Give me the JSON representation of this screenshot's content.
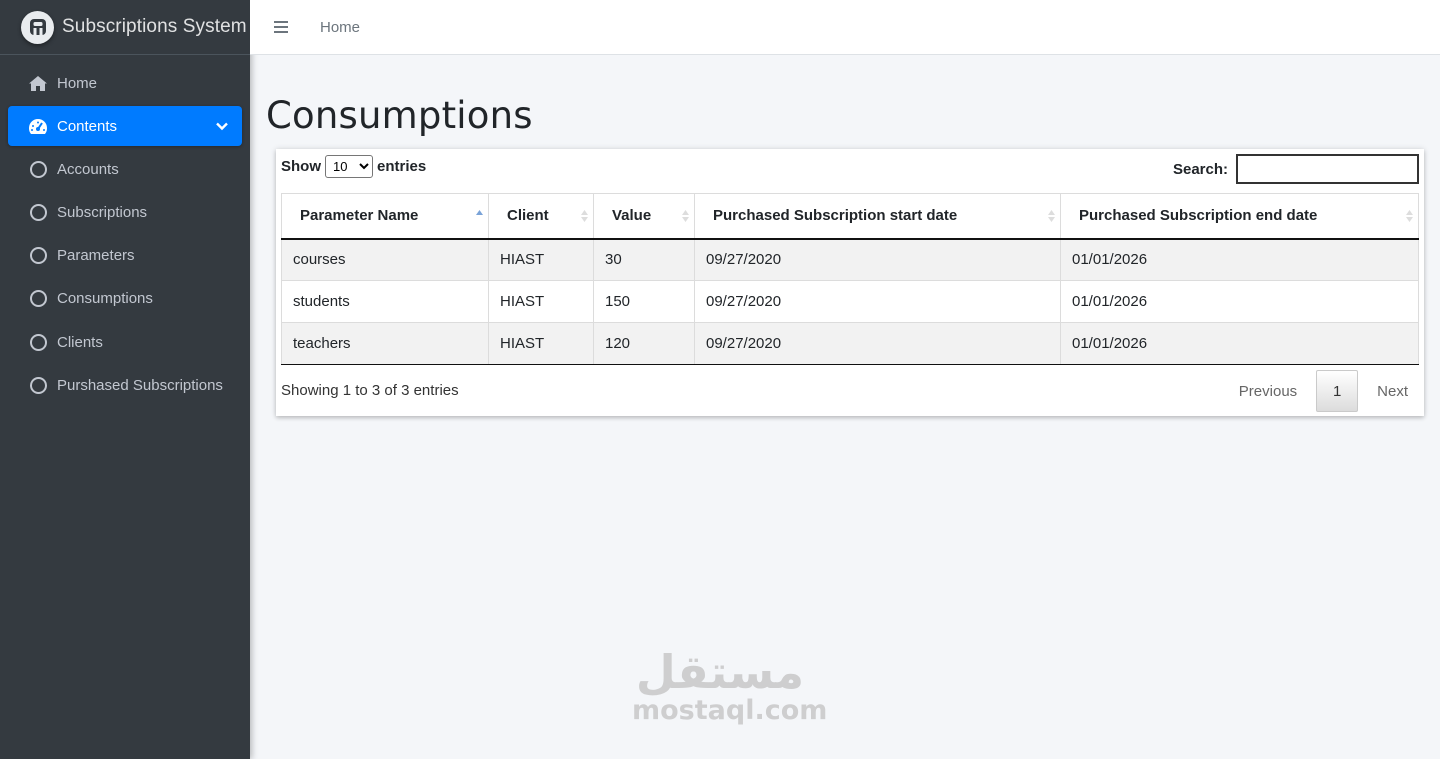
{
  "brand": {
    "title": "Subscriptions System"
  },
  "sidebar": {
    "items": [
      {
        "label": "Home",
        "icon": "home-icon",
        "active": false
      },
      {
        "label": "Contents",
        "icon": "dashboard-icon",
        "active": true
      },
      {
        "label": "Accounts",
        "icon": "circle-icon",
        "active": false
      },
      {
        "label": "Subscriptions",
        "icon": "circle-icon",
        "active": false
      },
      {
        "label": "Parameters",
        "icon": "circle-icon",
        "active": false
      },
      {
        "label": "Consumptions",
        "icon": "circle-icon",
        "active": false
      },
      {
        "label": "Clients",
        "icon": "circle-icon",
        "active": false
      },
      {
        "label": "Purshased Subscriptions",
        "icon": "circle-icon",
        "active": false
      }
    ]
  },
  "topbar": {
    "home_link": "Home"
  },
  "page": {
    "title": "Consumptions"
  },
  "table_controls": {
    "show_label": "Show",
    "entries_label": "entries",
    "page_length": "10",
    "search_label": "Search:",
    "search_value": ""
  },
  "table": {
    "columns": [
      "Parameter Name",
      "Client",
      "Value",
      "Purchased Subscription start date",
      "Purchased Subscription end date"
    ],
    "rows": [
      [
        "courses",
        "HIAST",
        "30",
        "09/27/2020",
        "01/01/2026"
      ],
      [
        "students",
        "HIAST",
        "150",
        "09/27/2020",
        "01/01/2026"
      ],
      [
        "teachers",
        "HIAST",
        "120",
        "09/27/2020",
        "01/01/2026"
      ]
    ]
  },
  "footer": {
    "info": "Showing 1 to 3 of 3 entries",
    "previous": "Previous",
    "current_page": "1",
    "next": "Next"
  },
  "watermark": {
    "arabic": "مستقل",
    "latin": "mostaql.com"
  },
  "colors": {
    "sidebar_bg": "#343a40",
    "active": "#007bff",
    "content_bg": "#f4f6f9"
  }
}
